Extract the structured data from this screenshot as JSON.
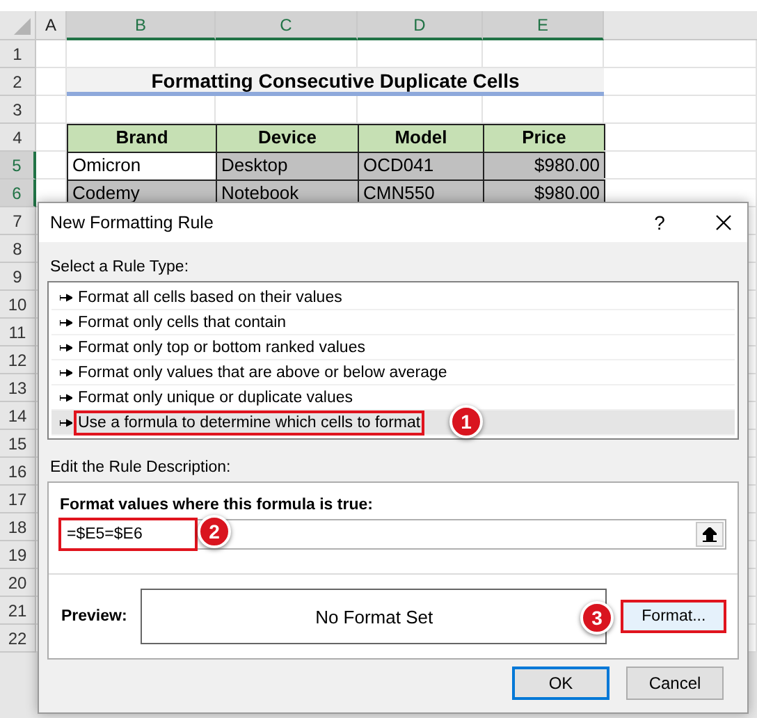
{
  "sheet": {
    "columns": [
      {
        "label": "A",
        "selected": false
      },
      {
        "label": "B",
        "selected": true
      },
      {
        "label": "C",
        "selected": true
      },
      {
        "label": "D",
        "selected": true
      },
      {
        "label": "E",
        "selected": true
      }
    ],
    "rows": [
      {
        "number": "1",
        "kind": "blank",
        "selected": false
      },
      {
        "number": "2",
        "kind": "title",
        "selected": false,
        "title": "Formatting Consecutive Duplicate Cells"
      },
      {
        "number": "3",
        "kind": "blank",
        "selected": false
      },
      {
        "number": "4",
        "kind": "header",
        "selected": false,
        "cells": [
          {
            "text": "Brand"
          },
          {
            "text": "Device"
          },
          {
            "text": "Model"
          },
          {
            "text": "Price"
          }
        ]
      },
      {
        "number": "5",
        "kind": "data",
        "selected": true,
        "cells": [
          {
            "text": "Omicron",
            "highlighted": false
          },
          {
            "text": "Desktop",
            "highlighted": true
          },
          {
            "text": "OCD041",
            "highlighted": true
          },
          {
            "text": "$980.00",
            "highlighted": true
          }
        ]
      },
      {
        "number": "6",
        "kind": "data",
        "selected": true,
        "cells": [
          {
            "text": "Codemy",
            "highlighted": true
          },
          {
            "text": "Notebook",
            "highlighted": true
          },
          {
            "text": "CMN550",
            "highlighted": true
          },
          {
            "text": "$980.00",
            "highlighted": true
          }
        ]
      },
      {
        "number": "7",
        "kind": "blank",
        "selected": false
      },
      {
        "number": "8",
        "kind": "blank",
        "selected": false
      },
      {
        "number": "9",
        "kind": "blank",
        "selected": false
      },
      {
        "number": "10",
        "kind": "blank",
        "selected": false
      },
      {
        "number": "11",
        "kind": "blank",
        "selected": false
      },
      {
        "number": "12",
        "kind": "blank",
        "selected": false
      },
      {
        "number": "13",
        "kind": "blank",
        "selected": false
      },
      {
        "number": "14",
        "kind": "blank",
        "selected": false
      },
      {
        "number": "15",
        "kind": "blank",
        "selected": false
      },
      {
        "number": "16",
        "kind": "blank",
        "selected": false
      },
      {
        "number": "17",
        "kind": "blank",
        "selected": false
      },
      {
        "number": "18",
        "kind": "blank",
        "selected": false
      },
      {
        "number": "19",
        "kind": "blank",
        "selected": false
      },
      {
        "number": "20",
        "kind": "blank",
        "selected": false
      },
      {
        "number": "21",
        "kind": "blank",
        "selected": false
      },
      {
        "number": "22",
        "kind": "blank",
        "selected": false
      }
    ]
  },
  "dialog": {
    "title": "New Formatting Rule",
    "help": "?",
    "rule_type_label": "Select a Rule Type:",
    "rule_types": [
      {
        "label": "Format all cells based on their values",
        "selected": false
      },
      {
        "label": "Format only cells that contain",
        "selected": false
      },
      {
        "label": "Format only top or bottom ranked values",
        "selected": false
      },
      {
        "label": "Format only values that are above or below average",
        "selected": false
      },
      {
        "label": "Format only unique or duplicate values",
        "selected": false
      },
      {
        "label": "Use a formula to determine which cells to format",
        "selected": true,
        "callout": "1"
      }
    ],
    "description_label": "Edit the Rule Description:",
    "formula_label": "Format values where this formula is true:",
    "formula": {
      "value": "=$E5=$E6",
      "callout": "2"
    },
    "preview_label": "Preview:",
    "preview_text": "No Format Set",
    "format_button": {
      "label": "Format...",
      "callout": "3"
    },
    "buttons": [
      {
        "label": "OK",
        "kind": "default"
      },
      {
        "label": "Cancel",
        "kind": "normal"
      }
    ]
  }
}
